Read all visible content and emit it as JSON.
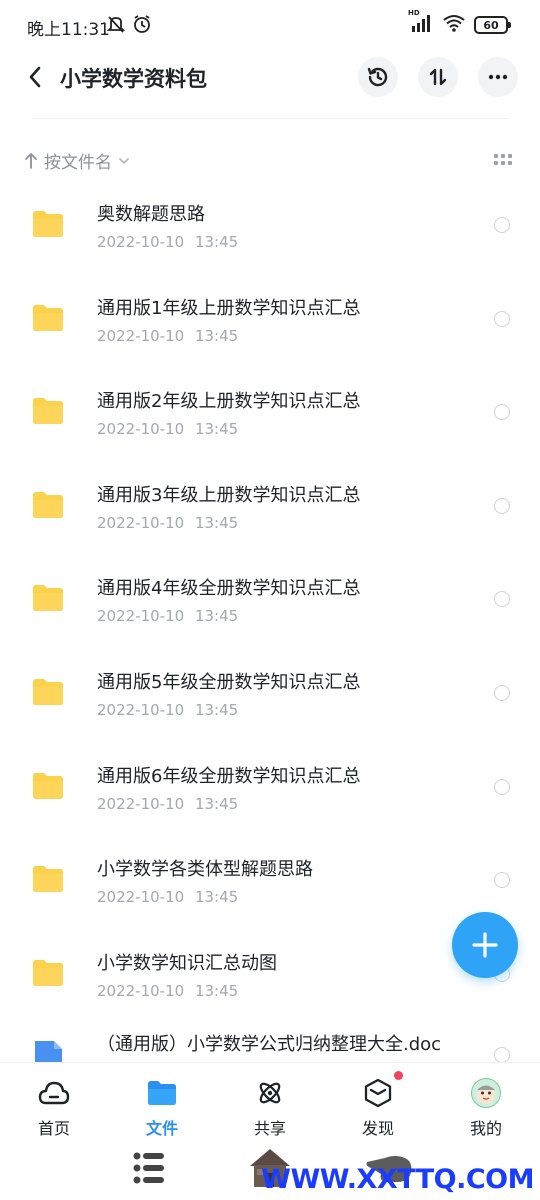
{
  "status": {
    "time": "晚上11:31",
    "battery": "60",
    "net_label": "HD"
  },
  "header": {
    "title": "小学数学资料包"
  },
  "sort": {
    "label": "按文件名"
  },
  "files": [
    {
      "name": "奥数解题思路",
      "date": "2022-10-10",
      "time": "13:45",
      "type": "folder"
    },
    {
      "name": "通用版1年级上册数学知识点汇总",
      "date": "2022-10-10",
      "time": "13:45",
      "type": "folder"
    },
    {
      "name": "通用版2年级上册数学知识点汇总",
      "date": "2022-10-10",
      "time": "13:45",
      "type": "folder"
    },
    {
      "name": "通用版3年级上册数学知识点汇总",
      "date": "2022-10-10",
      "time": "13:45",
      "type": "folder"
    },
    {
      "name": "通用版4年级全册数学知识点汇总",
      "date": "2022-10-10",
      "time": "13:45",
      "type": "folder"
    },
    {
      "name": "通用版5年级全册数学知识点汇总",
      "date": "2022-10-10",
      "time": "13:45",
      "type": "folder"
    },
    {
      "name": "通用版6年级全册数学知识点汇总",
      "date": "2022-10-10",
      "time": "13:45",
      "type": "folder"
    },
    {
      "name": "小学数学各类体型解题思路",
      "date": "2022-10-10",
      "time": "13:45",
      "type": "folder"
    },
    {
      "name": "小学数学知识汇总动图",
      "date": "2022-10-10",
      "time": "13:45",
      "type": "folder"
    },
    {
      "name": "（通用版）小学数学公式归纳整理大全.doc",
      "date": "",
      "time": "",
      "type": "doc"
    }
  ],
  "nav": [
    {
      "label": "首页",
      "icon": "cloud-home-icon"
    },
    {
      "label": "文件",
      "icon": "folder-icon",
      "active": true
    },
    {
      "label": "共享",
      "icon": "atom-share-icon"
    },
    {
      "label": "发现",
      "icon": "cube-discover-icon",
      "badge": true
    },
    {
      "label": "我的",
      "icon": "avatar-icon"
    }
  ],
  "watermark": "WWW.XXTTQ.COM",
  "colors": {
    "accent": "#2b8ff0",
    "fab": "#2fa3f5",
    "folder": "#fbd24b",
    "doc": "#4a90f0",
    "badge": "#f2445c"
  }
}
